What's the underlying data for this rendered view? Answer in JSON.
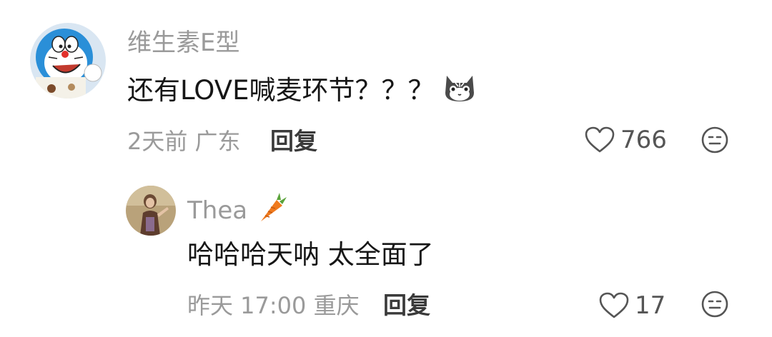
{
  "comments": [
    {
      "username": "维生素E型",
      "content": "还有LOVE喊麦环节？？？",
      "content_emoji": "cat-emoji",
      "time": "2天前",
      "location": "广东",
      "reply_label": "回复",
      "likes": "766",
      "avatar": "doraemon-avatar"
    },
    {
      "username": "Thea",
      "username_emoji": "carrot-emoji",
      "content": "哈哈哈天呐 太全面了",
      "time": "昨天 17:00",
      "location": "重庆",
      "reply_label": "回复",
      "likes": "17",
      "avatar": "person-photo-avatar"
    }
  ],
  "colors": {
    "meta_text": "#9a9a9a",
    "content_text": "#161616",
    "reply_text": "#3a3a3a"
  }
}
